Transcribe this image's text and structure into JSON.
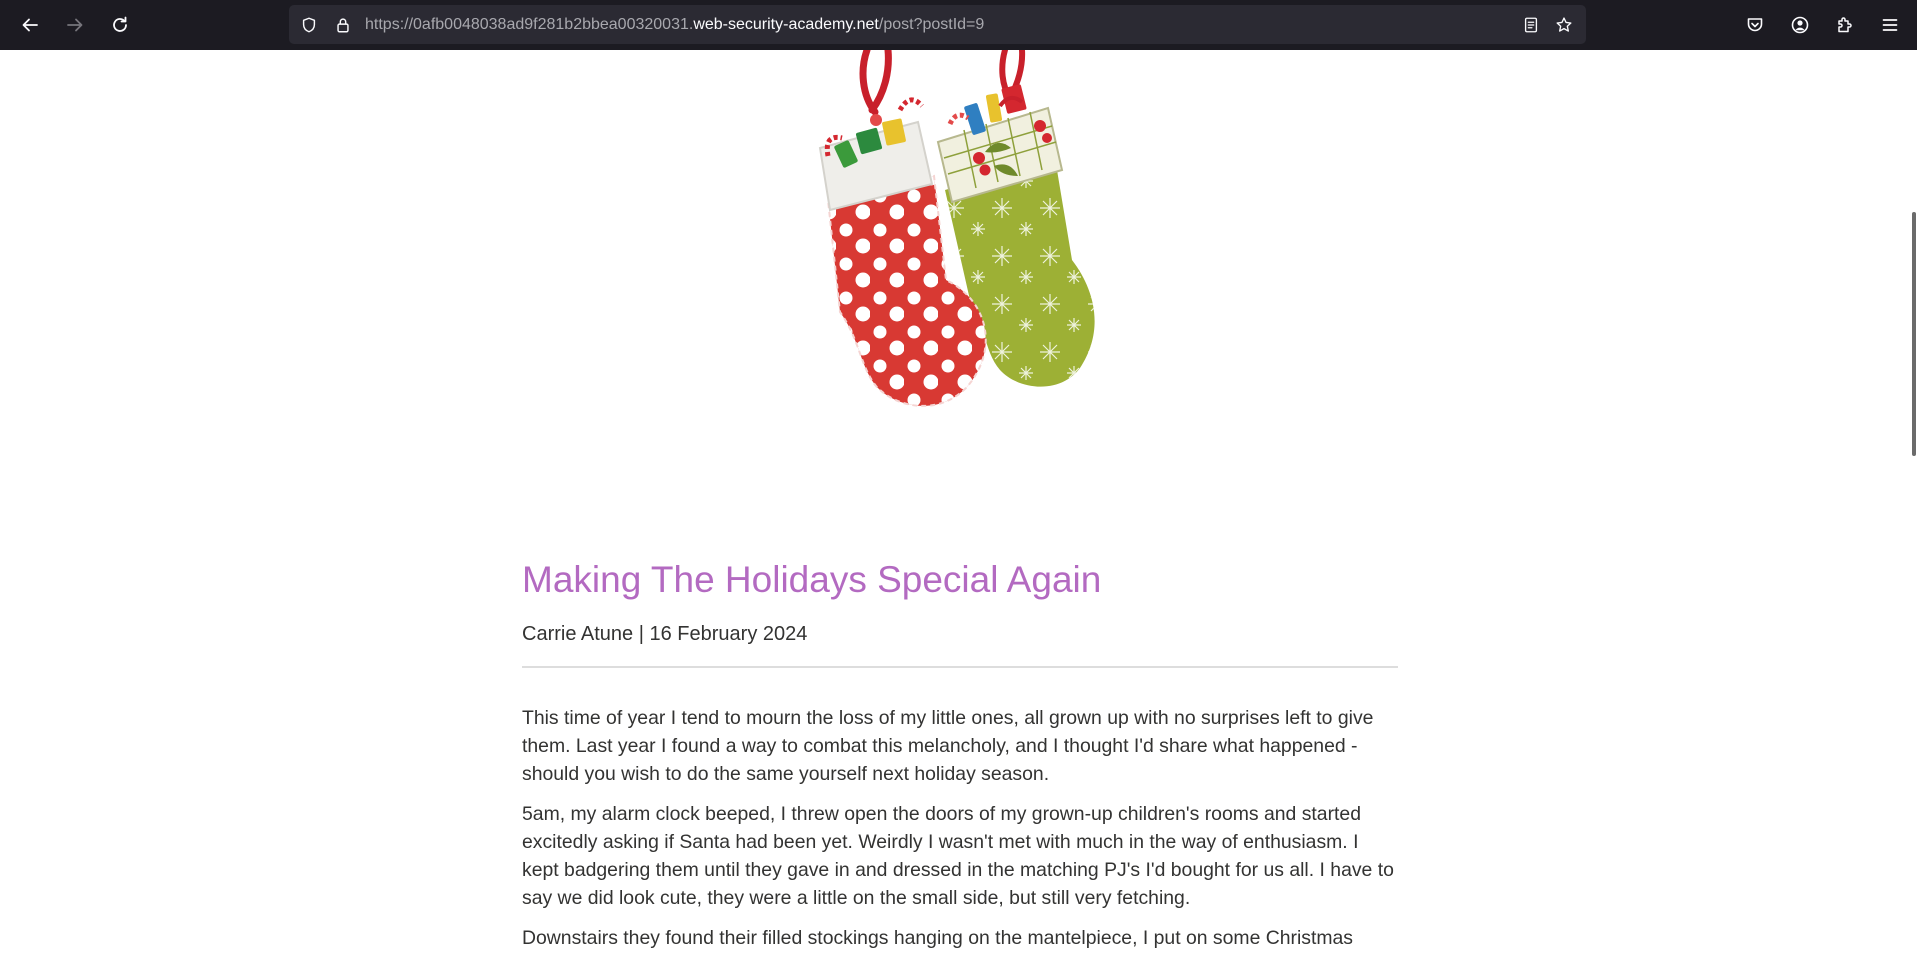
{
  "browser": {
    "url_prefix": "https://0afb0048038ad9f281b2bbea00320031.",
    "url_host": "web-security-academy.net",
    "url_path": "/post?postId=9",
    "icons": {
      "back": "back-arrow-icon",
      "forward": "forward-arrow-icon",
      "reload": "reload-icon",
      "shield": "tracking-protection-shield-icon",
      "lock": "lock-icon",
      "reader": "reader-view-icon",
      "bookmark": "bookmark-star-icon",
      "pocket": "pocket-icon",
      "account": "account-icon",
      "extensions": "extensions-icon",
      "menu": "hamburger-menu-icon"
    }
  },
  "post": {
    "image_subject": "two christmas stockings",
    "title": "Making The Holidays Special Again",
    "meta": "Carrie Atune | 16 February 2024",
    "paragraphs": [
      "This time of year I tend to mourn the loss of my little ones, all grown up with no surprises left to give them. Last year I found a way to combat this melancholy, and I thought I'd share what happened - should you wish to do the same yourself next holiday season.",
      "5am, my alarm clock beeped, I threw open the doors of my grown-up children's rooms and started excitedly asking if Santa had been yet. Weirdly I wasn't met with much in the way of enthusiasm. I kept badgering them until they gave in and dressed in the matching PJ's I'd bought for us all. I have to say we did look cute, they were a little on the small side, but still very fetching.",
      "Downstairs they found their filled stockings hanging on the mantelpiece, I put on some Christmas music, exactly the kind little children enjoy. Then asked several times if I could turn it"
    ]
  },
  "colors": {
    "title": "#b36ac1",
    "text": "#333332",
    "toolbar": "#1c1b22",
    "urlbar": "#2b2a33"
  }
}
